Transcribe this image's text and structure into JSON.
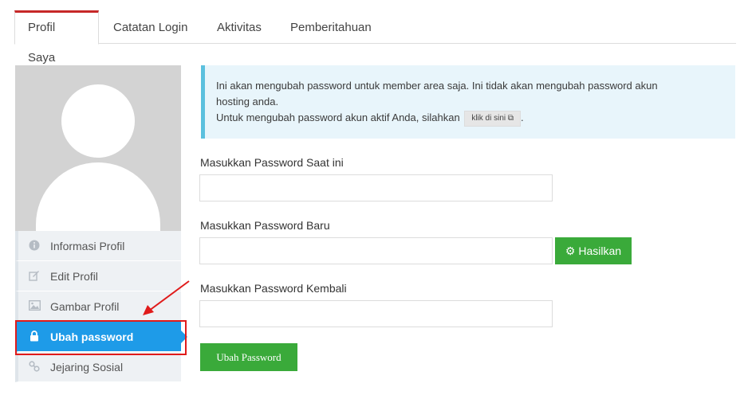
{
  "tabs": [
    {
      "label": "Profil Saya",
      "active": true
    },
    {
      "label": "Catatan Login",
      "active": false
    },
    {
      "label": "Aktivitas",
      "active": false
    },
    {
      "label": "Pemberitahuan",
      "active": false
    }
  ],
  "sidebar": {
    "items": [
      {
        "label": "Informasi Profil",
        "icon": "info-circle-icon"
      },
      {
        "label": "Edit Profil",
        "icon": "edit-icon"
      },
      {
        "label": "Gambar Profil",
        "icon": "image-icon"
      },
      {
        "label": "Ubah password",
        "icon": "lock-icon",
        "active": true
      },
      {
        "label": "Jejaring Sosial",
        "icon": "link-icon"
      }
    ]
  },
  "alert": {
    "line1": "Ini akan mengubah password untuk member area saja. Ini tidak akan mengubah password akun",
    "line2": "hosting anda.",
    "line3": "Untuk mengubah password akun aktif Anda, silahkan",
    "link_label": "klik di sini",
    "line3_end": "."
  },
  "form": {
    "current_label": "Masukkan Password Saat ini",
    "current_value": "",
    "new_label": "Masukkan Password Baru",
    "new_value": "",
    "generate_label": "Hasilkan",
    "confirm_label": "Masukkan Password Kembali",
    "confirm_value": "",
    "submit_label": "Ubah Password"
  },
  "colors": {
    "accent_active": "#1e9be8",
    "tab_active_border": "#c62828",
    "button_green": "#3aaa3a",
    "annotation_red": "#e01b1b"
  }
}
